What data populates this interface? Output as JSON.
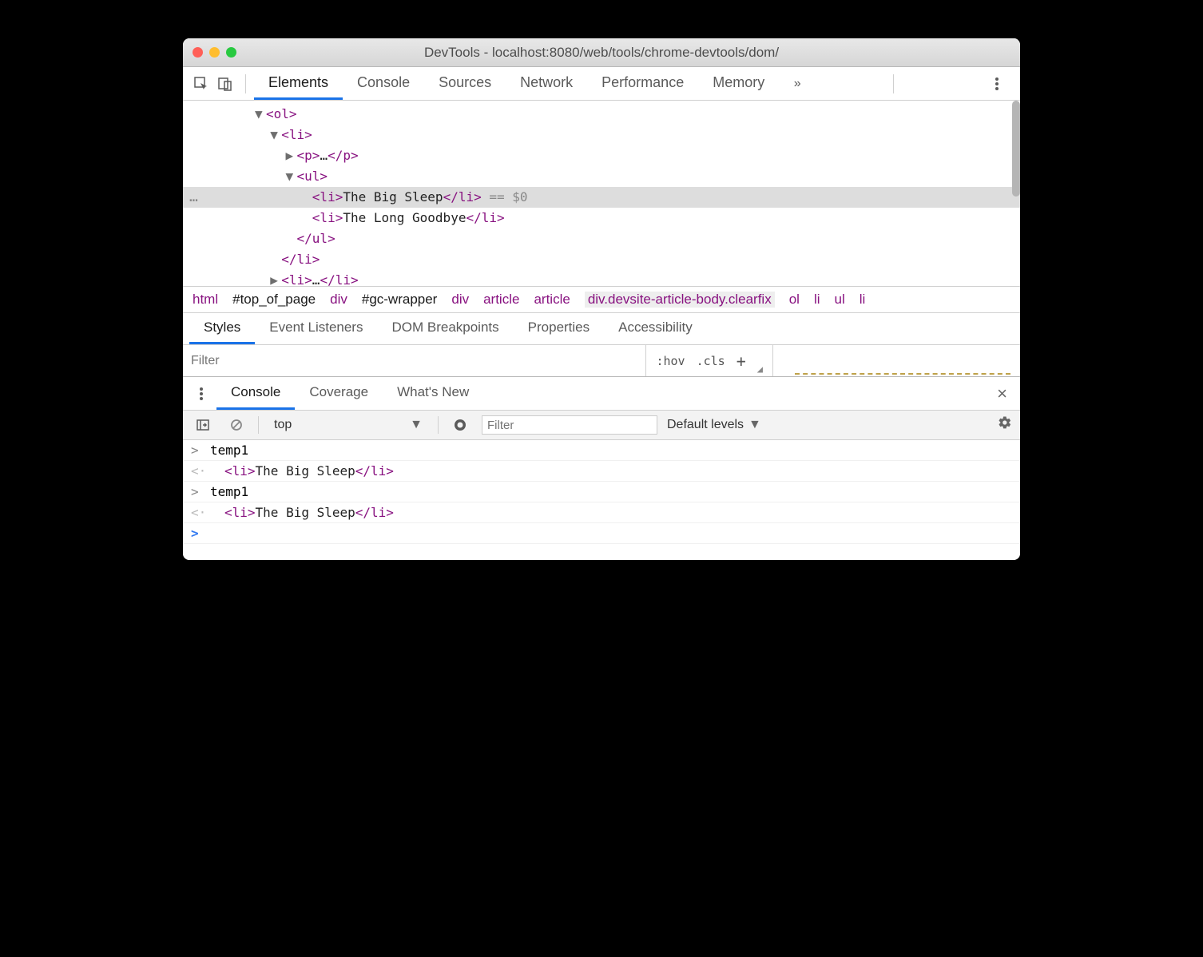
{
  "window": {
    "title": "DevTools - localhost:8080/web/tools/chrome-devtools/dom/"
  },
  "mainTabs": {
    "items": [
      "Elements",
      "Console",
      "Sources",
      "Network",
      "Performance",
      "Memory"
    ],
    "activeIndex": 0,
    "overflowGlyph": "»"
  },
  "domTree": {
    "lines": [
      {
        "indent": 0,
        "arrow": "▼",
        "open": "<ol>",
        "text": "",
        "close": "",
        "selected": false
      },
      {
        "indent": 1,
        "arrow": "▼",
        "open": "<li>",
        "text": "",
        "close": "",
        "selected": false
      },
      {
        "indent": 2,
        "arrow": "▶",
        "open": "<p>",
        "text": "…",
        "close": "</p>",
        "selected": false
      },
      {
        "indent": 2,
        "arrow": "▼",
        "open": "<ul>",
        "text": "",
        "close": "",
        "selected": false
      },
      {
        "indent": 3,
        "arrow": "",
        "open": "<li>",
        "text": "The Big Sleep",
        "close": "</li>",
        "suffix": " == $0",
        "selected": true
      },
      {
        "indent": 3,
        "arrow": "",
        "open": "<li>",
        "text": "The Long Goodbye",
        "close": "</li>",
        "selected": false
      },
      {
        "indent": 2,
        "arrow": "",
        "open": "</ul>",
        "text": "",
        "close": "",
        "selected": false
      },
      {
        "indent": 1,
        "arrow": "",
        "open": "</li>",
        "text": "",
        "close": "",
        "selected": false
      },
      {
        "indent": 1,
        "arrow": "▶",
        "open": "<li>",
        "text": "…",
        "close": "</li>",
        "selected": false
      }
    ]
  },
  "breadcrumb": {
    "items": [
      {
        "label": "html",
        "cls": ""
      },
      {
        "label": "#top_of_page",
        "cls": "black"
      },
      {
        "label": "div",
        "cls": ""
      },
      {
        "label": "#gc-wrapper",
        "cls": "black"
      },
      {
        "label": "div",
        "cls": ""
      },
      {
        "label": "article",
        "cls": ""
      },
      {
        "label": "article",
        "cls": ""
      },
      {
        "label": "div.devsite-article-body.clearfix",
        "cls": "hl"
      },
      {
        "label": "ol",
        "cls": ""
      },
      {
        "label": "li",
        "cls": ""
      },
      {
        "label": "ul",
        "cls": ""
      },
      {
        "label": "li",
        "cls": ""
      }
    ]
  },
  "stylesTabs": {
    "items": [
      "Styles",
      "Event Listeners",
      "DOM Breakpoints",
      "Properties",
      "Accessibility"
    ],
    "activeIndex": 0
  },
  "filterRow": {
    "placeholder": "Filter",
    "hov": ":hov",
    "cls": ".cls",
    "plus": "+"
  },
  "drawerTabs": {
    "items": [
      "Console",
      "Coverage",
      "What's New"
    ],
    "activeIndex": 0
  },
  "consoleToolbar": {
    "context": "top",
    "filterPlaceholder": "Filter",
    "levels": "Default levels"
  },
  "consoleRows": [
    {
      "kind": "in",
      "mk": ">",
      "text": "temp1"
    },
    {
      "kind": "out",
      "mk": "<·",
      "open": "<li>",
      "text": "The Big Sleep",
      "close": "</li>"
    },
    {
      "kind": "in",
      "mk": ">",
      "text": "temp1"
    },
    {
      "kind": "out",
      "mk": "<·",
      "open": "<li>",
      "text": "The Big Sleep",
      "close": "</li>"
    },
    {
      "kind": "prompt",
      "mk": ">",
      "text": ""
    }
  ]
}
